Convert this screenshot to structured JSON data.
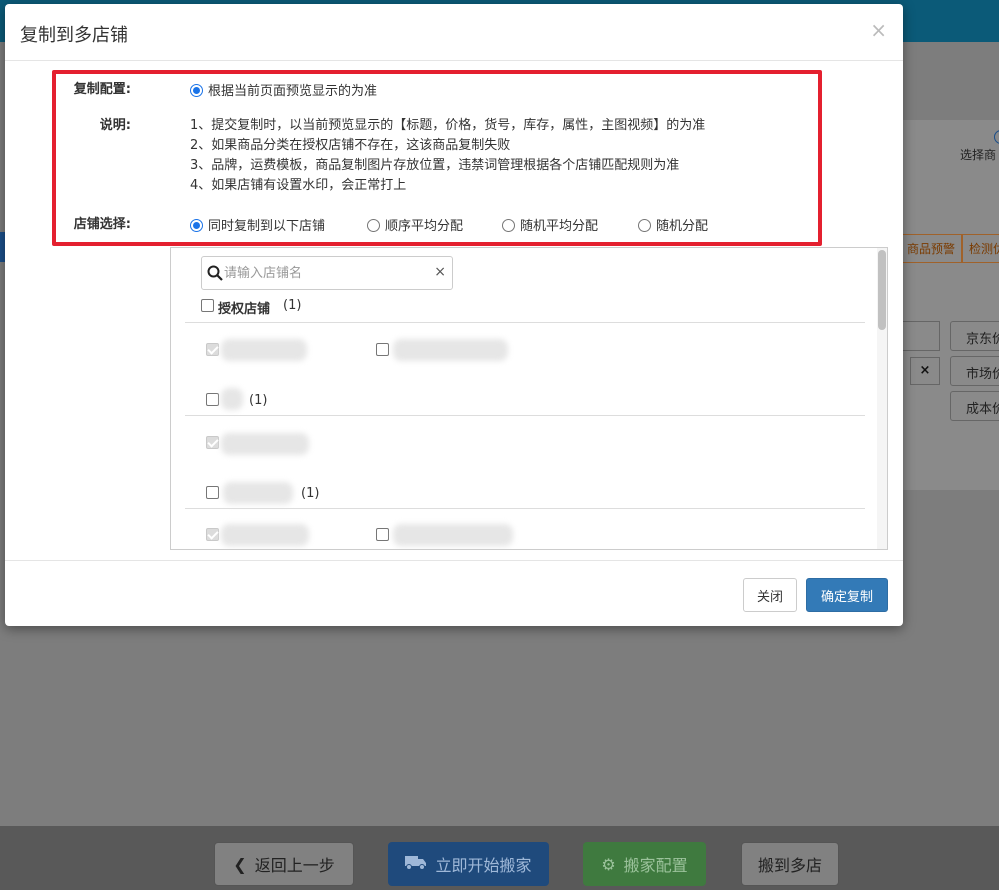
{
  "background": {
    "stepper_label": "选择商",
    "tabs": [
      "商品预警",
      "检测优"
    ],
    "buttons": [
      "京东价",
      "市场价",
      "成本价"
    ],
    "clear_symbol": "×"
  },
  "footer": {
    "back_label": "返回上一步",
    "start_label": "立即开始搬家",
    "config_label": "搬家配置",
    "multi_label": "搬到多店"
  },
  "modal": {
    "title": "复制到多店铺",
    "close_symbol": "×",
    "copy_config": {
      "label": "复制配置:",
      "option": "根据当前页面预览显示的为准"
    },
    "notes": {
      "label": "说明:",
      "lines": [
        "1、提交复制时，以当前预览显示的【标题，价格，货号，库存，属性，主图视频】的为准",
        "2、如果商品分类在授权店铺不存在，这该商品复制失败",
        "3、品牌，运费模板，商品复制图片存放位置，违禁词管理根据各个店铺匹配规则为准",
        "4、如果店铺有设置水印，会正常打上"
      ]
    },
    "store_select": {
      "label": "店铺选择:",
      "options": [
        "同时复制到以下店铺",
        "顺序平均分配",
        "随机平均分配",
        "随机分配"
      ]
    },
    "search": {
      "placeholder": "请输入店铺名",
      "clear_symbol": "×"
    },
    "groups": {
      "authorized_label": "授权店铺",
      "authorized_count": "(1)",
      "group2_count": "(1)",
      "group3_count": "(1)"
    },
    "buttons": {
      "close": "关闭",
      "confirm": "确定复制"
    }
  }
}
